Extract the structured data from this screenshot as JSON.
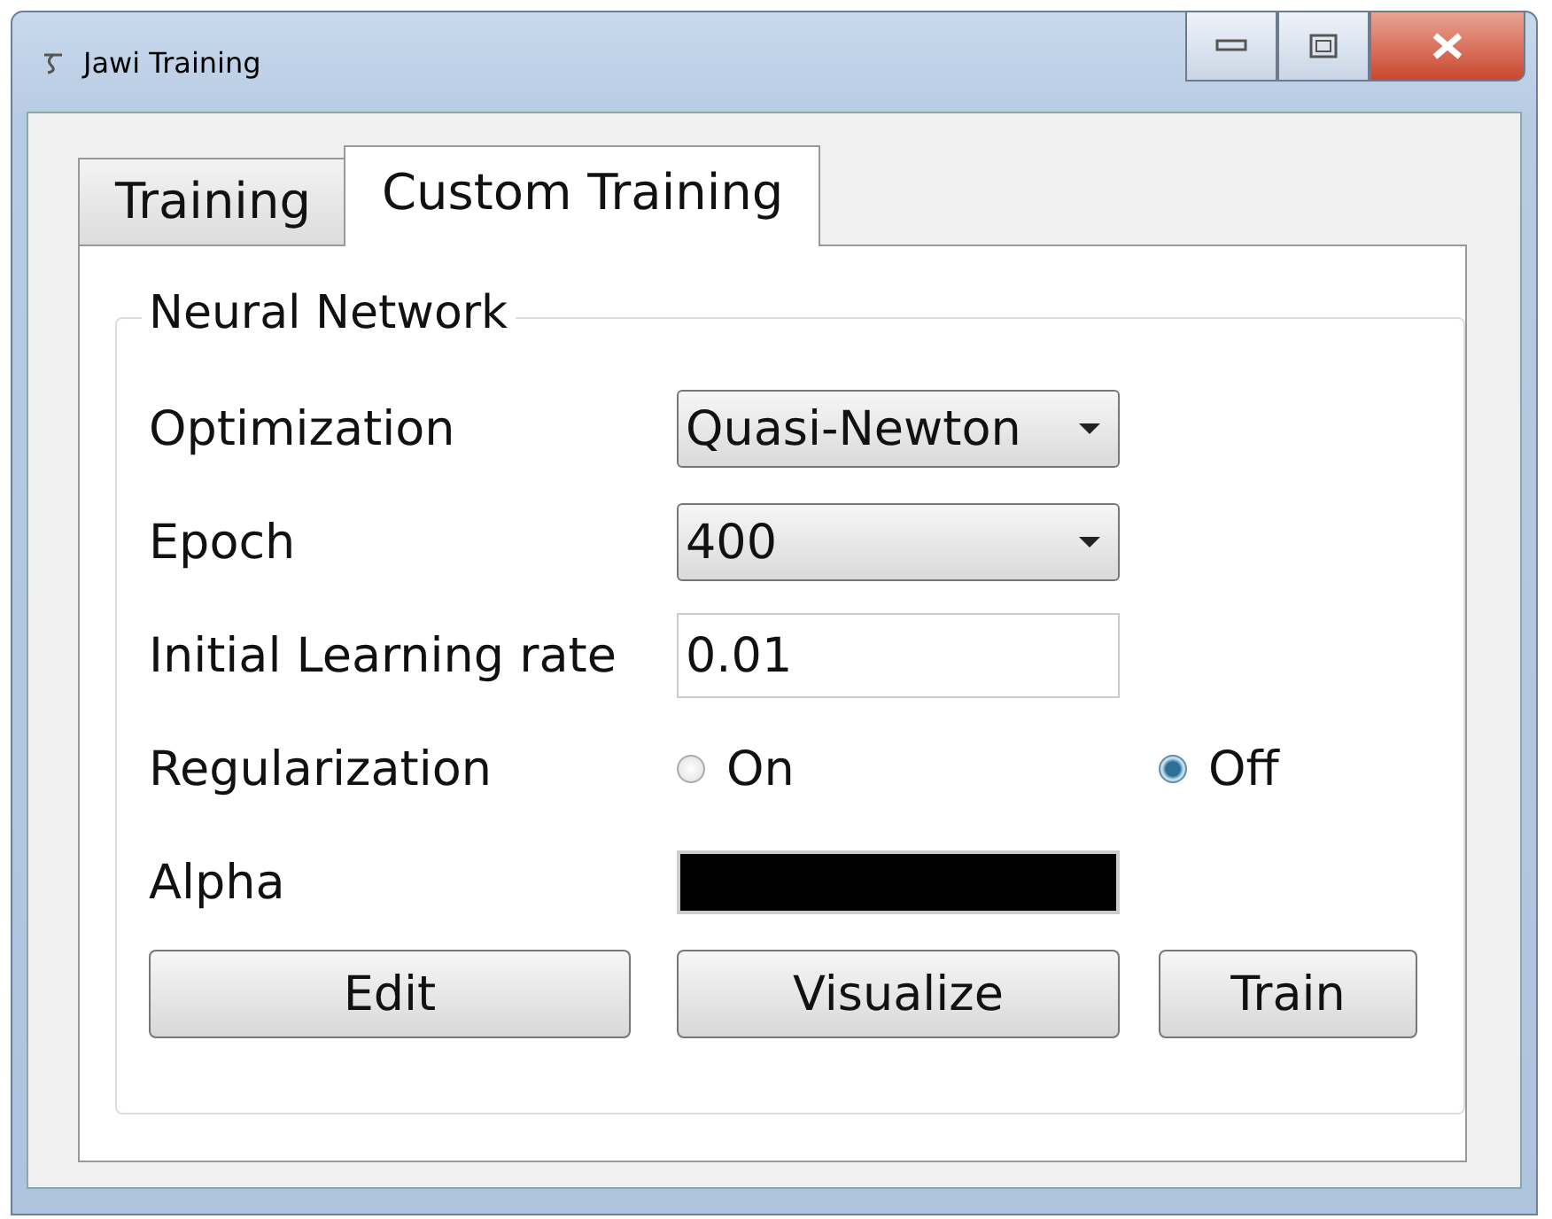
{
  "window": {
    "title": "Jawi Training"
  },
  "tabs": [
    {
      "label": "Training",
      "selected": false
    },
    {
      "label": "Custom Training",
      "selected": true
    }
  ],
  "group": {
    "title": "Neural Network",
    "rows": [
      {
        "kind": "dropdown",
        "label": "Optimization",
        "value": "Quasi-Newton"
      },
      {
        "kind": "dropdown",
        "label": "Epoch",
        "value": "400"
      },
      {
        "kind": "text",
        "label": "Initial Learning rate",
        "value": "0.01"
      },
      {
        "kind": "radio",
        "label": "Regularization",
        "options": [
          {
            "label": "On",
            "selected": false
          },
          {
            "label": "Off",
            "selected": true
          }
        ]
      },
      {
        "kind": "swatch",
        "label": "Alpha",
        "color": "#000000"
      }
    ],
    "buttons": [
      "Edit",
      "Visualize",
      "Train"
    ]
  }
}
